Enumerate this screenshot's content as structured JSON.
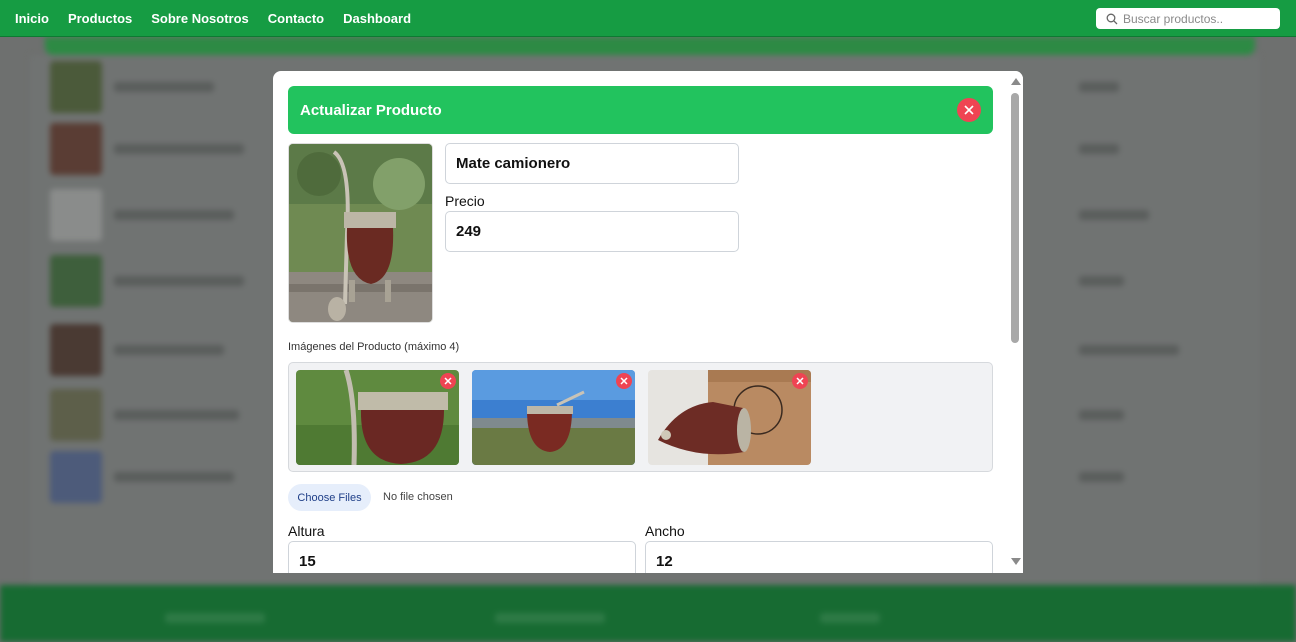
{
  "nav": {
    "links": [
      "Inicio",
      "Productos",
      "Sobre Nosotros",
      "Contacto",
      "Dashboard"
    ],
    "search_placeholder": "Buscar productos.."
  },
  "modal": {
    "title": "Actualizar Producto",
    "name_value": "Mate camionero",
    "price_label": "Precio",
    "price_value": "249",
    "images_label": "Imágenes del Producto (máximo 4)",
    "choose_files": "Choose Files",
    "no_file": "No file chosen",
    "height_label": "Altura",
    "height_value": "15",
    "width_label": "Ancho",
    "width_value": "12"
  },
  "colors": {
    "nav_green": "#169c43",
    "header_green": "#22c35e",
    "danger_red": "#ef4453"
  }
}
